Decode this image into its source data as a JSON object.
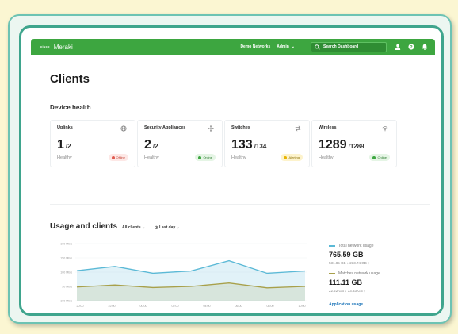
{
  "colors": {
    "brand_green": "#3da640",
    "total_line": "#5bb9d6",
    "matches_line": "#a8a04a",
    "offline": "#e05a4f",
    "online": "#3da640",
    "alerting": "#e8b400"
  },
  "topbar": {
    "logo_mark": "cisco",
    "logo_text": "Meraki",
    "network_label": "Demo Networks",
    "admin_label": "Admin",
    "search_placeholder": "Search Dashboard",
    "icons": [
      "user-icon",
      "help-icon",
      "bell-icon"
    ]
  },
  "page": {
    "title": "Clients",
    "device_health_title": "Device health",
    "usage_title": "Usage and clients",
    "filter_clients": "All clients",
    "filter_period": "Last day"
  },
  "health_cards": [
    {
      "label": "Uplinks",
      "icon": "globe-icon",
      "value": "1",
      "total": "/2",
      "sub": "Healthy",
      "badge": "Offline",
      "status": "offline"
    },
    {
      "label": "Security Appliances",
      "icon": "move-icon",
      "value": "2",
      "total": "/2",
      "sub": "Healthy",
      "badge": "Online",
      "status": "online"
    },
    {
      "label": "Switches",
      "icon": "switch-icon",
      "value": "133",
      "total": "/134",
      "sub": "Healthy",
      "badge": "Alerting",
      "status": "alerting"
    },
    {
      "label": "Wireless",
      "icon": "wifi-icon",
      "value": "1289",
      "total": "/1289",
      "sub": "Healthy",
      "badge": "Online",
      "status": "online"
    }
  ],
  "legend": {
    "total_label": "Total network usage",
    "total_value": "765.59 GB",
    "total_detail": "531.85 GB ↓  233.74 GB ↑",
    "matches_label": "Matches network usage",
    "matches_value": "111.11 GB",
    "matches_detail": "22.22 GB ↓  33.33 GB ↑",
    "link": "Application usage"
  },
  "chart_data": {
    "type": "area",
    "y_tick_labels": [
      "100 Mb/s",
      "150 Mb/s",
      "100 Mb/s",
      "50 Mb/s",
      "100 Mb/s"
    ],
    "x_tick_labels": [
      "20:00",
      "22:00",
      "00:00",
      "02:00",
      "04:00",
      "06:00",
      "08:00",
      "10:00"
    ],
    "ylim": [
      0,
      200
    ],
    "series": [
      {
        "name": "Total network usage",
        "values": [
          105,
          120,
          96,
          104,
          140,
          96,
          104
        ]
      },
      {
        "name": "Matches network usage",
        "values": [
          48,
          55,
          46,
          50,
          62,
          45,
          50
        ]
      }
    ]
  }
}
